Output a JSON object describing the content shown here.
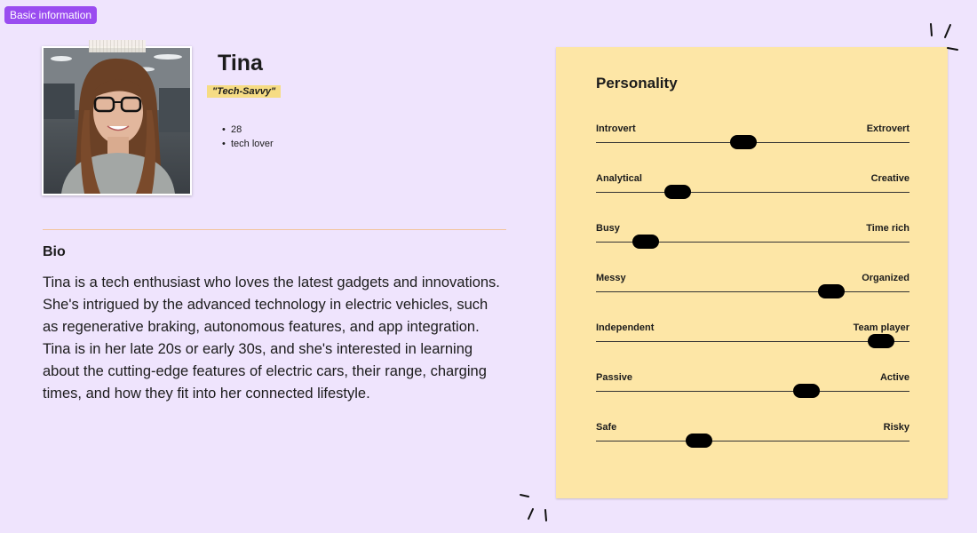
{
  "tag": {
    "label": "Basic information"
  },
  "profile": {
    "name": "Tina",
    "nickname": "\"Tech-Savvy\"",
    "facts": [
      "28",
      "tech lover"
    ]
  },
  "bio": {
    "heading": "Bio",
    "text": "Tina is a tech enthusiast who loves the latest gadgets and innovations. She's intrigued by the advanced technology in electric vehicles, such as regenerative braking, autonomous features, and app integration. Tina is in her late 20s or early 30s, and she's interested in learning about the cutting-edge features of electric cars, their range, charging times, and how they fit into her connected lifestyle."
  },
  "personality": {
    "title": "Personality",
    "traits": [
      {
        "left": "Introvert",
        "right": "Extrovert",
        "level": 0.47
      },
      {
        "left": "Analytical",
        "right": "Creative",
        "level": 0.26
      },
      {
        "left": "Busy",
        "right": "Time rich",
        "level": 0.16
      },
      {
        "left": "Messy",
        "right": "Organized",
        "level": 0.75
      },
      {
        "left": "Independent",
        "right": "Team player",
        "level": 0.91
      },
      {
        "left": "Passive",
        "right": "Active",
        "level": 0.67
      },
      {
        "left": "Safe",
        "right": "Risky",
        "level": 0.33
      }
    ]
  },
  "colors": {
    "background": "#efe4fd",
    "tag": "#9a4cf0",
    "card": "#fde6a6",
    "highlight": "#f6dc84"
  }
}
